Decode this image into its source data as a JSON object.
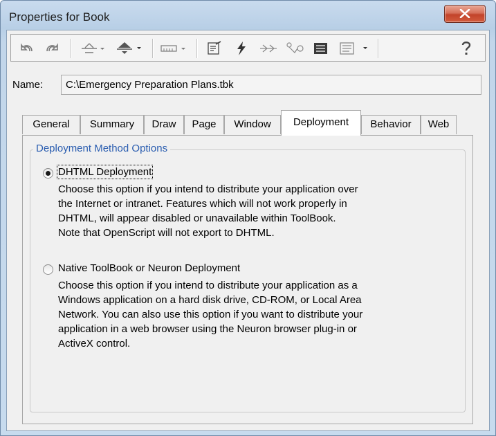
{
  "window": {
    "title": "Properties for Book"
  },
  "toolbar": {
    "icons": [
      "undo-icon",
      "redo-icon",
      "align-icon",
      "distribute-icon",
      "ruler-icon",
      "properties-icon",
      "events-icon",
      "connections-icon",
      "shapes-icon",
      "script-icon",
      "script-options-icon",
      "help-icon"
    ]
  },
  "name_field": {
    "label": "Name:",
    "value": "C:\\Emergency Preparation Plans.tbk"
  },
  "tabs": [
    {
      "label": "General"
    },
    {
      "label": "Summary"
    },
    {
      "label": "Draw"
    },
    {
      "label": "Page"
    },
    {
      "label": "Window"
    },
    {
      "label": "Deployment",
      "active": true
    },
    {
      "label": "Behavior"
    },
    {
      "label": "Web"
    }
  ],
  "group": {
    "title": "Deployment Method Options",
    "options": [
      {
        "label": "DHTML Deployment",
        "selected": true,
        "description": [
          "Choose this option if you intend to distribute your application over",
          "the Internet or intranet. Features which will not work properly in",
          "DHTML, will appear disabled or unavailable within ToolBook.",
          "Note that OpenScript will not export to DHTML."
        ]
      },
      {
        "label": "Native ToolBook or Neuron Deployment",
        "selected": false,
        "description": [
          "Choose this option if you intend to distribute your application as a",
          "Windows application on a hard disk drive, CD-ROM, or Local Area",
          "Network. You can also use this option if you want to distribute your",
          "application in a web browser using the Neuron browser plug-in or",
          "ActiveX control."
        ]
      }
    ]
  },
  "colors": {
    "group_title": "#2a5db0",
    "close_button": "#c2432a",
    "title_bar": "#c9dbee"
  }
}
